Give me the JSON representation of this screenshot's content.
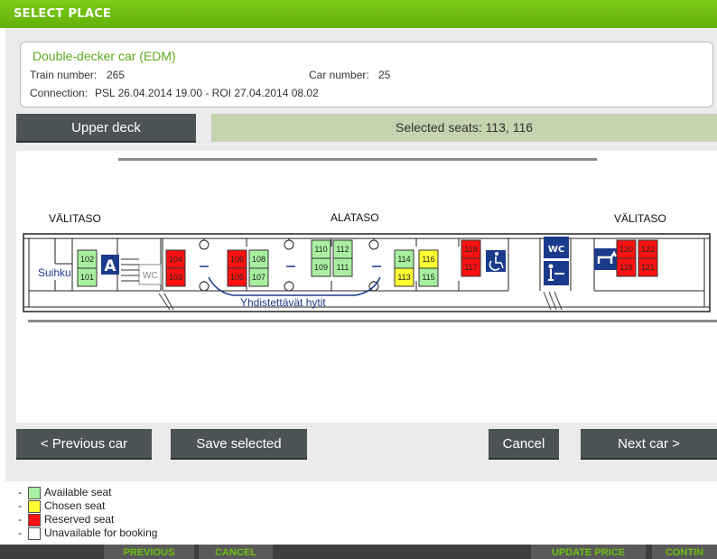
{
  "dialog": {
    "title": "SELECT PLACE"
  },
  "car": {
    "name": "Double-decker car (EDM)",
    "train_number_label": "Train number:",
    "train_number": "265",
    "car_number_label": "Car number:",
    "car_number": "25",
    "connection_label": "Connection:",
    "connection": "PSL 26.04.2014 19.00 - ROI 27.04.2014 08.02"
  },
  "deck_button": "Upper deck",
  "selected_seats": "Selected seats: 113, 116",
  "map": {
    "labels": {
      "left": "VÄLITASO",
      "center": "ALATASO",
      "right": "VÄLITASO",
      "shower": "Suihku",
      "connected": "Yhdistettävät hytit",
      "wc_small": "WC",
      "wc_box": "WC"
    },
    "colors": {
      "available": "#a8f0a0",
      "chosen": "#ffff33",
      "reserved": "#ff1111",
      "unavailable": "#ffffff",
      "sign": "#1a3a8c"
    },
    "seats": [
      {
        "num": "102",
        "status": "available"
      },
      {
        "num": "101",
        "status": "available"
      },
      {
        "num": "104",
        "status": "reserved"
      },
      {
        "num": "103",
        "status": "reserved"
      },
      {
        "num": "106",
        "status": "reserved"
      },
      {
        "num": "105",
        "status": "reserved"
      },
      {
        "num": "108",
        "status": "available"
      },
      {
        "num": "107",
        "status": "available"
      },
      {
        "num": "110",
        "status": "available"
      },
      {
        "num": "109",
        "status": "available"
      },
      {
        "num": "112",
        "status": "available"
      },
      {
        "num": "111",
        "status": "available"
      },
      {
        "num": "114",
        "status": "available"
      },
      {
        "num": "113",
        "status": "chosen"
      },
      {
        "num": "116",
        "status": "chosen"
      },
      {
        "num": "115",
        "status": "available"
      },
      {
        "num": "118",
        "status": "reserved"
      },
      {
        "num": "117",
        "status": "reserved"
      },
      {
        "num": "120",
        "status": "reserved"
      },
      {
        "num": "119",
        "status": "reserved"
      },
      {
        "num": "122",
        "status": "reserved"
      },
      {
        "num": "121",
        "status": "reserved"
      }
    ],
    "icons": [
      "a-sign-icon",
      "wheelchair-icon",
      "wc-sign-icon",
      "baby-changing-icon",
      "pet-icon"
    ]
  },
  "buttons": {
    "previous_car": "< Previous car",
    "save_selected": "Save selected",
    "cancel": "Cancel",
    "next_car": "Next car >"
  },
  "legend": [
    {
      "label": "Available seat",
      "color": "#a8f0a0"
    },
    {
      "label": "Chosen seat",
      "color": "#ffff33"
    },
    {
      "label": "Reserved seat",
      "color": "#ff1111"
    },
    {
      "label": "Unavailable for booking",
      "color": "#ffffff"
    }
  ],
  "background_bar": {
    "previous": "PREVIOUS",
    "cancel": "CANCEL",
    "update_price": "UPDATE PRICE",
    "continue": "CONTIN"
  }
}
